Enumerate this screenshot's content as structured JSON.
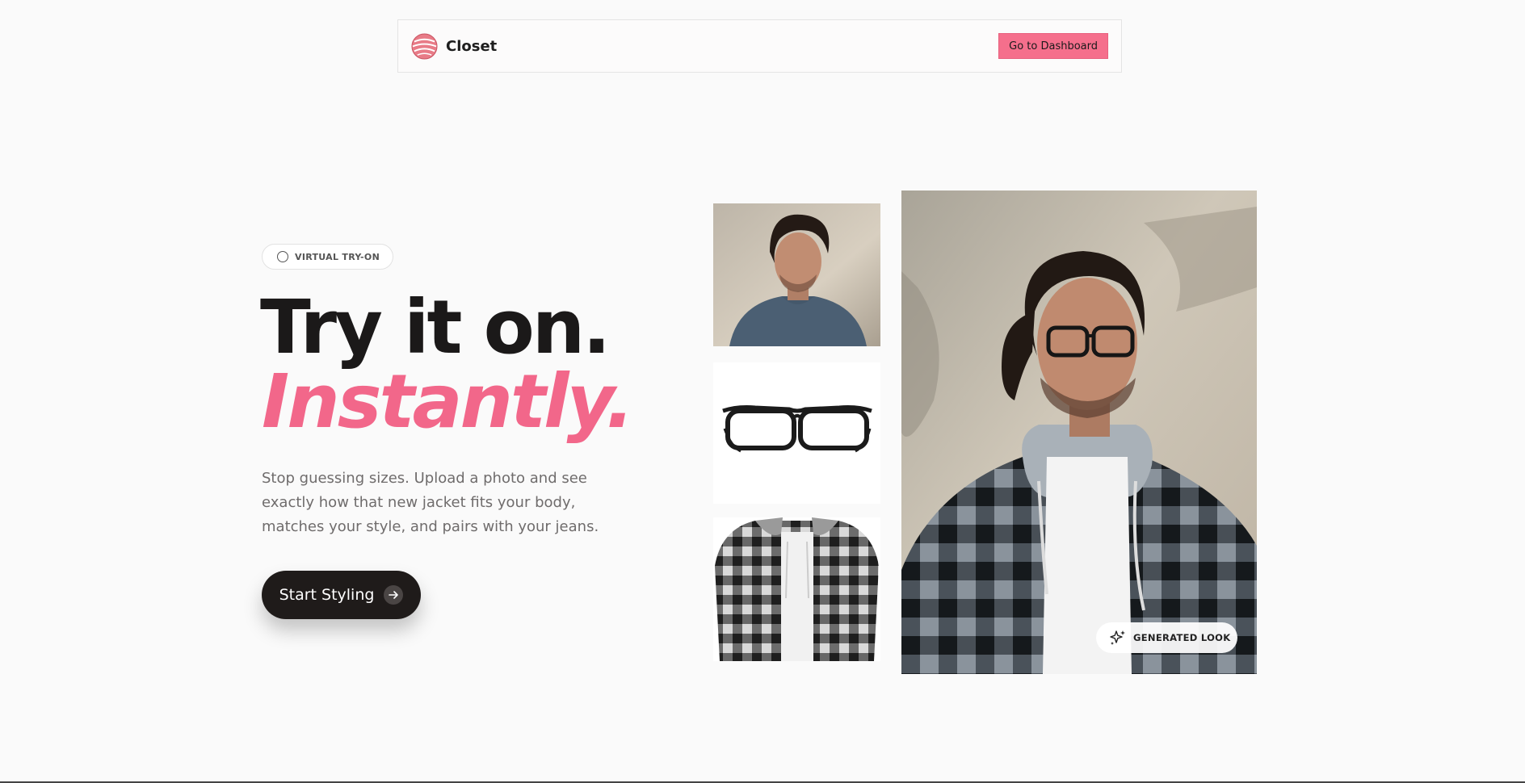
{
  "nav": {
    "brand_name": "Closet",
    "dashboard_button": "Go to Dashboard"
  },
  "hero": {
    "badge_label": "VIRTUAL TRY-ON",
    "headline_line1": "Try it on.",
    "headline_line2": "Instantly.",
    "description": "Stop guessing sizes. Upload a photo and see exactly how that new jacket fits your body, matches your style, and pairs with your jeans.",
    "cta_label": "Start Styling"
  },
  "gallery": {
    "generated_badge": "GENERATED LOOK",
    "items": [
      "person-photo",
      "glasses-photo",
      "jacket-photo",
      "generated-look-photo"
    ]
  },
  "colors": {
    "accent_pink": "#f2678a",
    "button_pink": "#f56f8c",
    "dark": "#1f1b1a",
    "background": "#fafafa"
  }
}
